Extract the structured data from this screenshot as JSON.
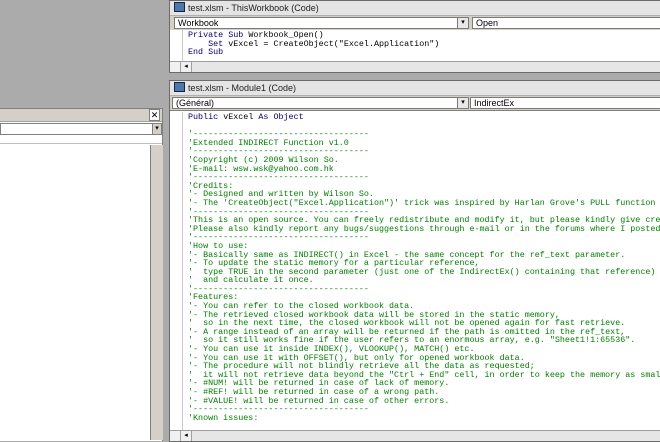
{
  "left_panel": {
    "close_glyph": "✕",
    "dropdown_glyph": "▾"
  },
  "window_top": {
    "title": "test.xlsm - ThisWorkbook (Code)",
    "object_combo": "Workbook",
    "proc_combo": "Open",
    "dropdown_glyph": "▾",
    "code_lines": [
      [
        [
          "kw",
          "Private Sub "
        ],
        [
          "pl",
          "Workbook_Open()"
        ]
      ],
      [
        [
          "pl",
          "    "
        ],
        [
          "kw",
          "Set "
        ],
        [
          "pl",
          "vExcel = CreateObject(\"Excel.Application\")"
        ]
      ],
      [
        [
          "kw",
          "End Sub"
        ]
      ]
    ],
    "scroll_left": "◂"
  },
  "window_main": {
    "title": "test.xlsm - Module1 (Code)",
    "object_combo": "(Général)",
    "proc_combo": "IndirectEx",
    "dropdown_glyph": "▾",
    "code_lines": [
      [
        [
          "kw",
          "Public "
        ],
        [
          "pl",
          "vExcel "
        ],
        [
          "kw",
          "As Object"
        ]
      ],
      [
        [
          "pl",
          ""
        ]
      ],
      [
        [
          "cm",
          "'-----------------------------------"
        ]
      ],
      [
        [
          "cm",
          "'Extended INDIRECT Function v1.0"
        ]
      ],
      [
        [
          "cm",
          "'-----------------------------------"
        ]
      ],
      [
        [
          "cm",
          "'Copyright (c) 2009 Wilson So."
        ]
      ],
      [
        [
          "cm",
          "'E-mail: wsw.wsk@yahoo.com.hk"
        ]
      ],
      [
        [
          "cm",
          "'-----------------------------------"
        ]
      ],
      [
        [
          "cm",
          "'Credits:"
        ]
      ],
      [
        [
          "cm",
          "'- Designed and written by Wilson So."
        ]
      ],
      [
        [
          "cm",
          "'- The 'CreateObject(\"Excel.Application\")' trick was inspired by Harlan Grove's PULL function source code."
        ]
      ],
      [
        [
          "cm",
          "'-----------------------------------"
        ]
      ],
      [
        [
          "cm",
          "'This is an open source. You can freely redistribute and modify it, but please kindly give credit to the contr"
        ]
      ],
      [
        [
          "cm",
          "'Please also kindly report any bugs/suggestions through e-mail or in the forums where I posted it."
        ]
      ],
      [
        [
          "cm",
          "'-----------------------------------"
        ]
      ],
      [
        [
          "cm",
          "'How to use:"
        ]
      ],
      [
        [
          "cm",
          "'- Basically same as INDIRECT() in Excel - the same concept for the ref_text parameter."
        ]
      ],
      [
        [
          "cm",
          "'- To update the static memory for a particular reference,"
        ]
      ],
      [
        [
          "cm",
          "'  type TRUE in the second parameter (just one of the IndirectEx() containing that reference)"
        ]
      ],
      [
        [
          "cm",
          "'  and calculate it once."
        ]
      ],
      [
        [
          "cm",
          "'-----------------------------------"
        ]
      ],
      [
        [
          "cm",
          "'Features:"
        ]
      ],
      [
        [
          "cm",
          "'- You can refer to the closed workbook data."
        ]
      ],
      [
        [
          "cm",
          "'- The retrieved closed workbook data will be stored in the static memory,"
        ]
      ],
      [
        [
          "cm",
          "'  so in the next time, the closed workbook will not be opened again for fast retrieve."
        ]
      ],
      [
        [
          "cm",
          "'- A range instead of an array will be returned if the path is omitted in the ref_text,"
        ]
      ],
      [
        [
          "cm",
          "'  so it still works fine if the user refers to an enormous array, e.g. \"Sheet1!1:65536\"."
        ]
      ],
      [
        [
          "cm",
          "'- You can use it inside INDEX(), VLOOKUP(), MATCH() etc."
        ]
      ],
      [
        [
          "cm",
          "'- You can use it with OFFSET(), but only for opened workbook data."
        ]
      ],
      [
        [
          "cm",
          "'- The procedure will not blindly retrieve all the data as requested;"
        ]
      ],
      [
        [
          "cm",
          "'  it will not retrieve data beyond the \"Ctrl + End\" cell, in order to keep the memory as small as possible."
        ]
      ],
      [
        [
          "cm",
          "'- #NUM! will be returned in case of lack of memory."
        ]
      ],
      [
        [
          "cm",
          "'- #REF! will be returned in case of a wrong path."
        ]
      ],
      [
        [
          "cm",
          "'- #VALUE! will be returned in case of other errors."
        ]
      ],
      [
        [
          "cm",
          "'-----------------------------------"
        ]
      ],
      [
        [
          "cm",
          "'Known issues:"
        ]
      ]
    ],
    "scroll_left": "◂"
  }
}
